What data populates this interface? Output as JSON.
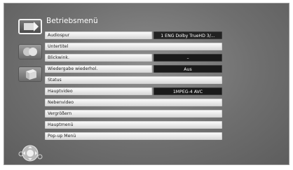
{
  "menu": {
    "title": "Betriebsmenü",
    "items": [
      {
        "label": "Audiospur",
        "value": "1 ENG Dolby TrueHD  3/..."
      },
      {
        "label": "Untertitel"
      },
      {
        "label": "Blickwink.",
        "value": "–"
      },
      {
        "label": "Wiedergabe wiederhol.",
        "value": "Aus"
      },
      {
        "label": "Status"
      },
      {
        "label": "Hauptvideo",
        "value": "1MPEG-4 AVC"
      },
      {
        "label": "Nebenvideo"
      },
      {
        "label": "Vergrößern"
      },
      {
        "label": "Hauptmenü"
      },
      {
        "label": "Pop-up Menü"
      }
    ]
  },
  "side_tabs": [
    {
      "icon": "play-disc-icon",
      "selected": true
    },
    {
      "icon": "audio-icon",
      "selected": false
    },
    {
      "icon": "box-settings-icon",
      "selected": false
    }
  ],
  "footer": {
    "icon": "dpad-navigation-icon"
  }
}
